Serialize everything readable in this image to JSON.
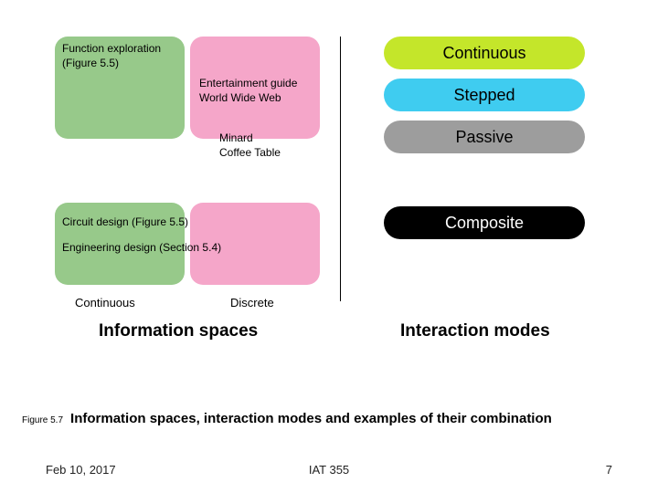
{
  "boxes": {
    "function_exploration": "Function exploration\n(Figure 5.5)",
    "entertainment": "Entertainment guide\nWorld Wide Web",
    "minard": "Minard\nCoffee Table",
    "circuit": "Circuit design (Figure 5.5)",
    "engineering": "Engineering design (Section 5.4)"
  },
  "axis": {
    "continuous": "Continuous",
    "discrete": "Discrete"
  },
  "sections": {
    "info_spaces": "Information spaces",
    "interaction_modes": "Interaction modes"
  },
  "modes": {
    "continuous": "Continuous",
    "stepped": "Stepped",
    "passive": "Passive",
    "composite": "Composite"
  },
  "caption": {
    "fig_num": "Figure 5.7",
    "text": "Information spaces, interaction modes and examples of their combination"
  },
  "footer": {
    "date": "Feb 10, 2017",
    "course": "IAT 355",
    "page": "7"
  }
}
